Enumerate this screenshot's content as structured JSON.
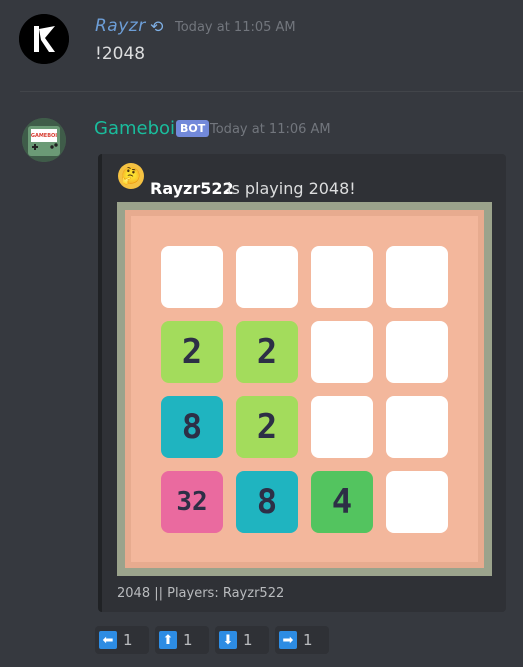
{
  "message1": {
    "username": "Rayzr",
    "badge_icon": "rotating-arrow-icon",
    "timestamp": "Today at 11:05 AM",
    "content": "!2048"
  },
  "message2": {
    "username": "Gameboi",
    "bot_tag": "BOT",
    "timestamp": "Today at 11:06 AM",
    "avatar_text": "GAMEBOI",
    "embed": {
      "author_icon": "thinking-face-icon",
      "author_name": "Rayzr522",
      "author_rest": "is playing 2048!",
      "board": [
        [
          "",
          "",
          "",
          ""
        ],
        [
          "2",
          "2",
          "",
          ""
        ],
        [
          "8",
          "2",
          "",
          ""
        ],
        [
          "32",
          "8",
          "4",
          ""
        ]
      ],
      "footer": "2048 || Players: Rayzr522"
    }
  },
  "reactions": [
    {
      "icon": "left-arrow-icon",
      "glyph": "⬅",
      "count": "1"
    },
    {
      "icon": "up-arrow-icon",
      "glyph": "⬆",
      "count": "1"
    },
    {
      "icon": "down-arrow-icon",
      "glyph": "⬇",
      "count": "1"
    },
    {
      "icon": "right-arrow-icon",
      "glyph": "➡",
      "count": "1"
    }
  ],
  "colors": {
    "tile_empty": "#ffffff",
    "tile_2": "#a3dc5c",
    "tile_8": "#1fb4c0",
    "tile_4": "#53c45f",
    "tile_32": "#ea6a9f",
    "text_dark": "#2d2f46"
  }
}
